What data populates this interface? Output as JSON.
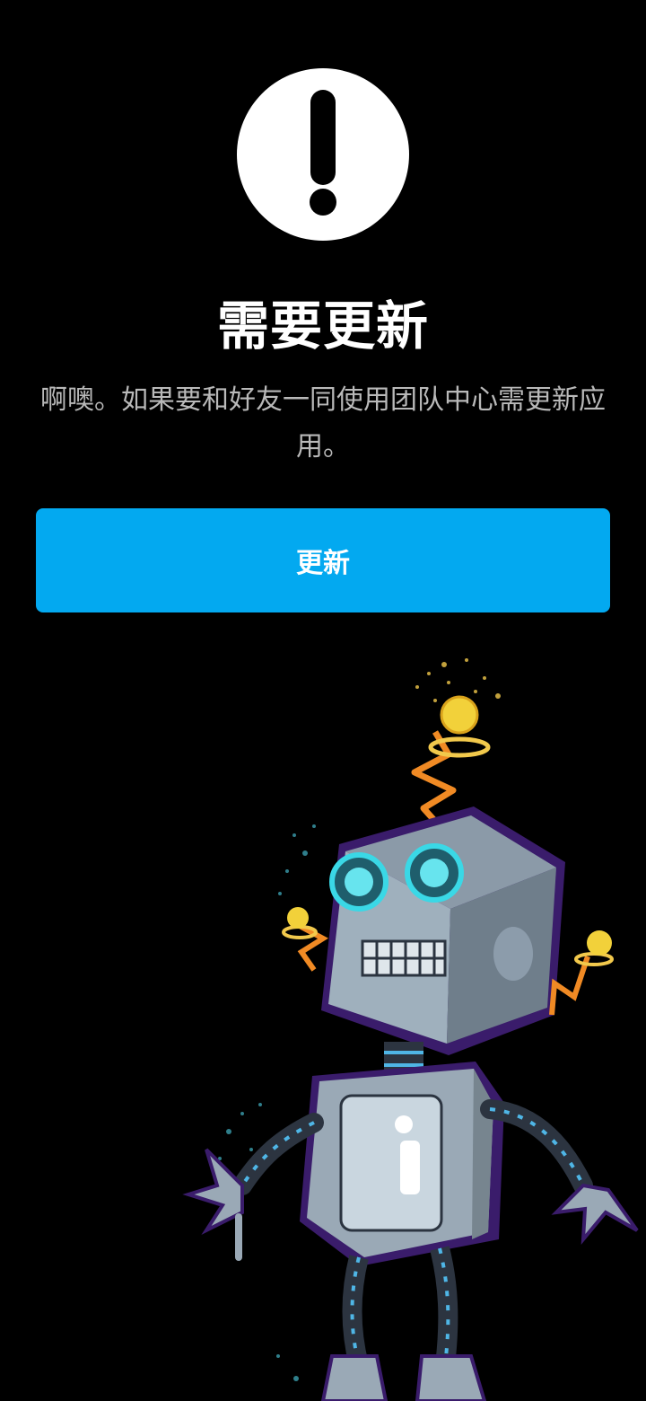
{
  "alert": {
    "icon": "exclamation-circle-icon",
    "title": "需要更新",
    "message": "啊噢。如果要和好友一同使用团队中心需更新应用。"
  },
  "actions": {
    "update_label": "更新"
  },
  "illustration": {
    "name": "robot-illustration"
  },
  "colors": {
    "background": "#000000",
    "accent": "#03a9f0",
    "message_text": "#b9b9b9"
  }
}
